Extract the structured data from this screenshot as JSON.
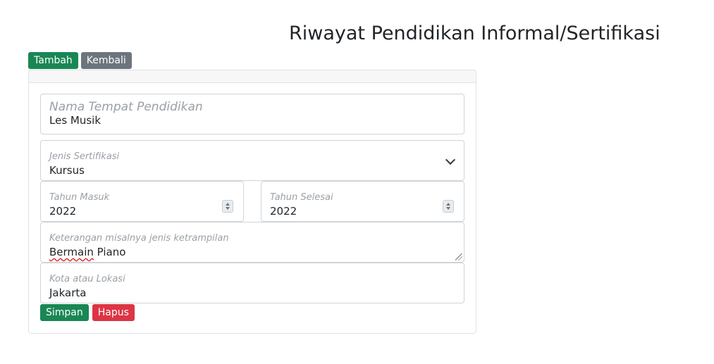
{
  "header": {
    "title": "Riwayat Pendidikan Informal/Sertifikasi"
  },
  "toolbar": {
    "add_label": "Tambah",
    "back_label": "Kembali"
  },
  "form": {
    "institution": {
      "label": "Nama Tempat Pendidikan",
      "value": "Les Musik"
    },
    "certification_type": {
      "label": "Jenis Sertifikasi",
      "value": "Kursus"
    },
    "start_year": {
      "label": "Tahun Masuk",
      "value": "2022"
    },
    "end_year": {
      "label": "Tahun Selesai",
      "value": "2022"
    },
    "description": {
      "label": "Keterangan misalnya jenis ketrampilan",
      "value_word1": "Bermain",
      "value_word2": " Piano"
    },
    "location": {
      "label": "Kota atau Lokasi",
      "value": "Jakarta"
    },
    "save_label": "Simpan",
    "delete_label": "Hapus"
  },
  "colors": {
    "success": "#198754",
    "secondary": "#6c757d",
    "danger": "#dc3545"
  }
}
